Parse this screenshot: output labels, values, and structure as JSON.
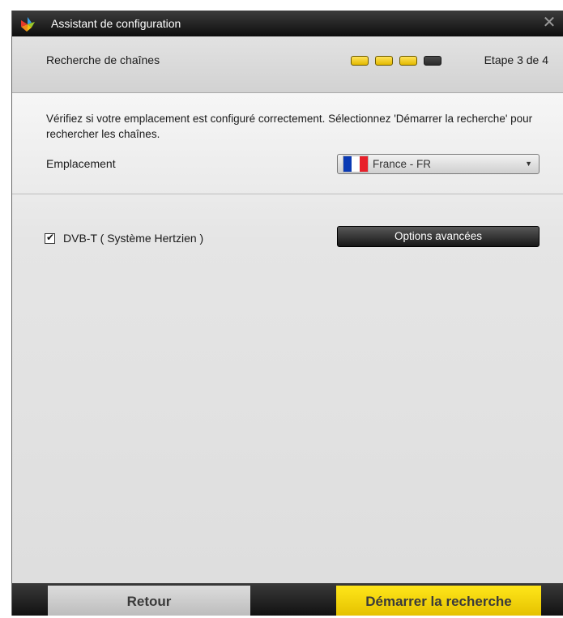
{
  "window": {
    "title": "Assistant de configuration",
    "close_glyph": "✕",
    "app_icon": "app-logo-icon"
  },
  "header": {
    "step_title": "Recherche de chaînes",
    "steps_total": 4,
    "steps_done": 3,
    "step_label": "Etape 3 de 4",
    "step_done_color": "#f0c800",
    "step_todo_color": "#333333"
  },
  "content": {
    "intro": "Vérifiez si votre emplacement est configuré correctement. Sélectionnez 'Démarrer la recherche' pour rechercher les chaînes.",
    "location_label": "Emplacement",
    "location_value": "France - FR",
    "location_flag": "france-flag-icon",
    "dvb_checked": true,
    "dvb_label": "DVB-T ( Système Hertzien )",
    "advanced_button": "Options avancées"
  },
  "footer": {
    "back_button": "Retour",
    "start_button": "Démarrer la recherche",
    "start_color": "#f5d800"
  }
}
